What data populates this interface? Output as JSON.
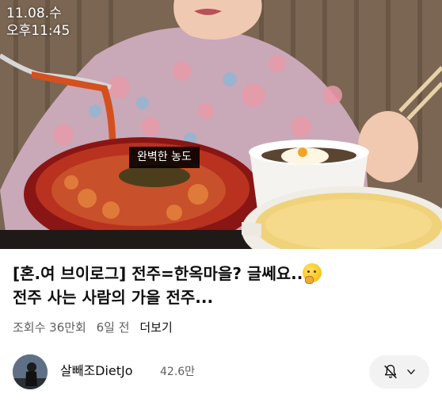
{
  "video": {
    "overlay_date": "11.08.수",
    "overlay_time": "오후11:45",
    "caption": "완벽한 농도"
  },
  "title": {
    "line1": "[혼.여 브이로그] 전주=한옥마을? 글쎄요..",
    "line2": "전주 사는 사람의 가을 전주...",
    "emoji": "thinking-face"
  },
  "meta": {
    "views": "조회수 36만회",
    "age": "6일 전",
    "more": "더보기"
  },
  "channel": {
    "name": "살빼조DietJo",
    "subscribers": "42.6만"
  },
  "icons": {
    "bell": "bell-off-icon",
    "chevron": "chevron-down-icon"
  }
}
